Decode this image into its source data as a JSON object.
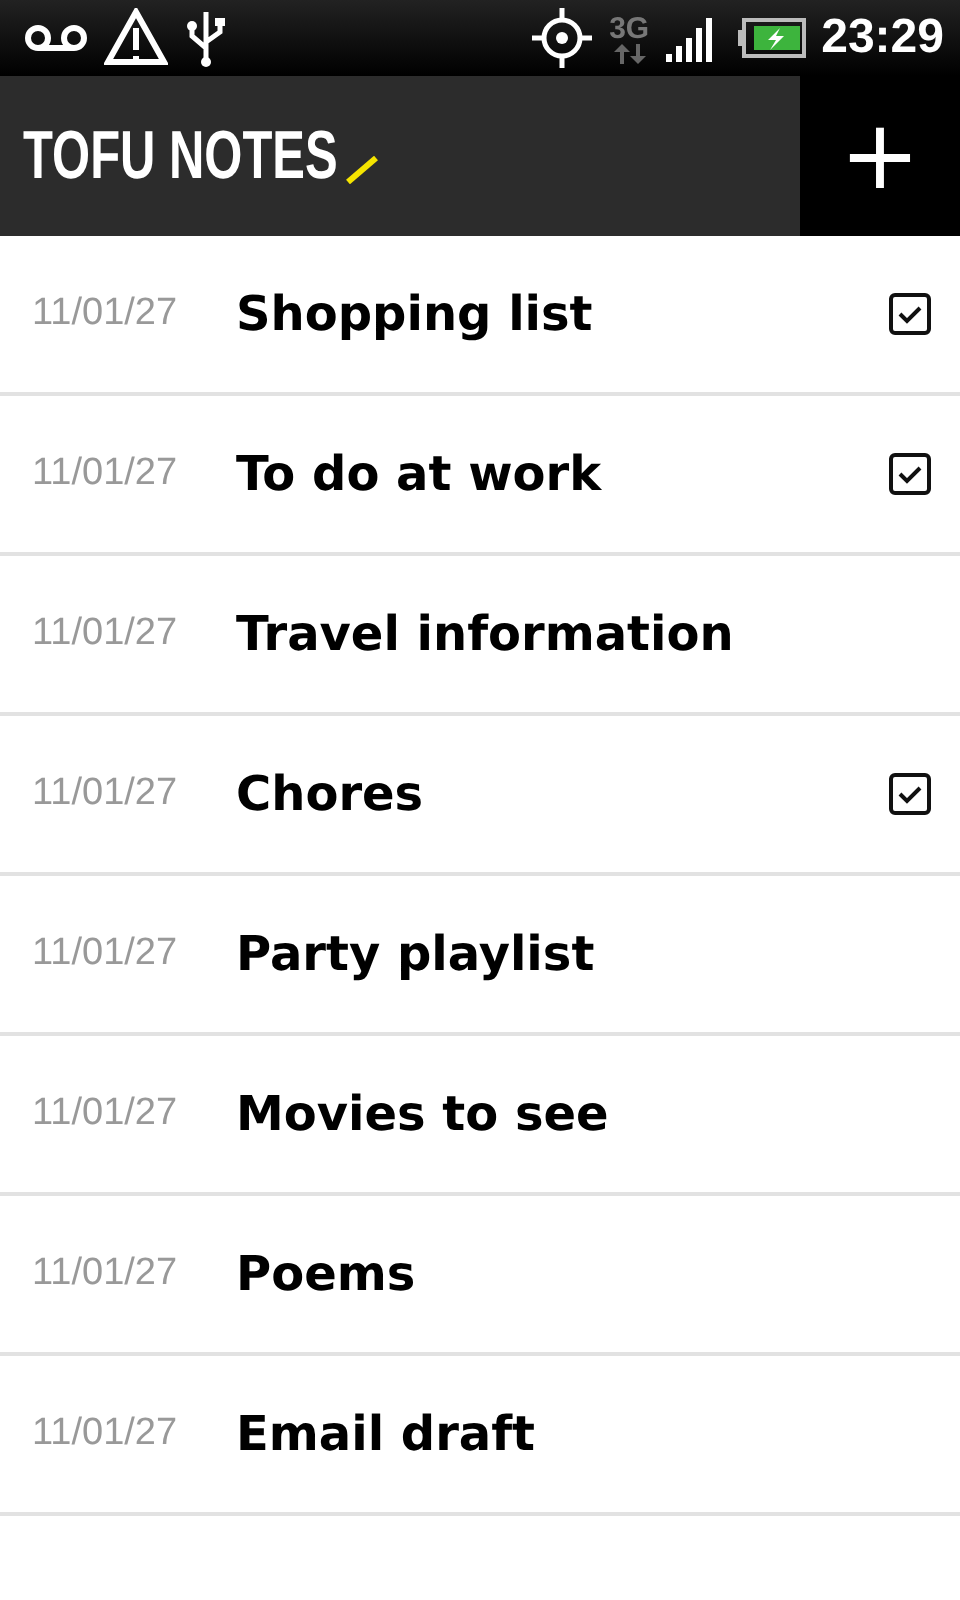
{
  "status_bar": {
    "network": "3G",
    "time": "23:29"
  },
  "app_bar": {
    "title": "TOFU NOTES",
    "add_label": "+"
  },
  "notes": [
    {
      "date": "11/01/27",
      "title": "Shopping list",
      "checklist": true
    },
    {
      "date": "11/01/27",
      "title": "To do at work",
      "checklist": true
    },
    {
      "date": "11/01/27",
      "title": "Travel information",
      "checklist": false
    },
    {
      "date": "11/01/27",
      "title": "Chores",
      "checklist": true
    },
    {
      "date": "11/01/27",
      "title": "Party playlist",
      "checklist": false
    },
    {
      "date": "11/01/27",
      "title": "Movies to see",
      "checklist": false
    },
    {
      "date": "11/01/27",
      "title": "Poems",
      "checklist": false
    },
    {
      "date": "11/01/27",
      "title": "Email draft",
      "checklist": false
    }
  ]
}
